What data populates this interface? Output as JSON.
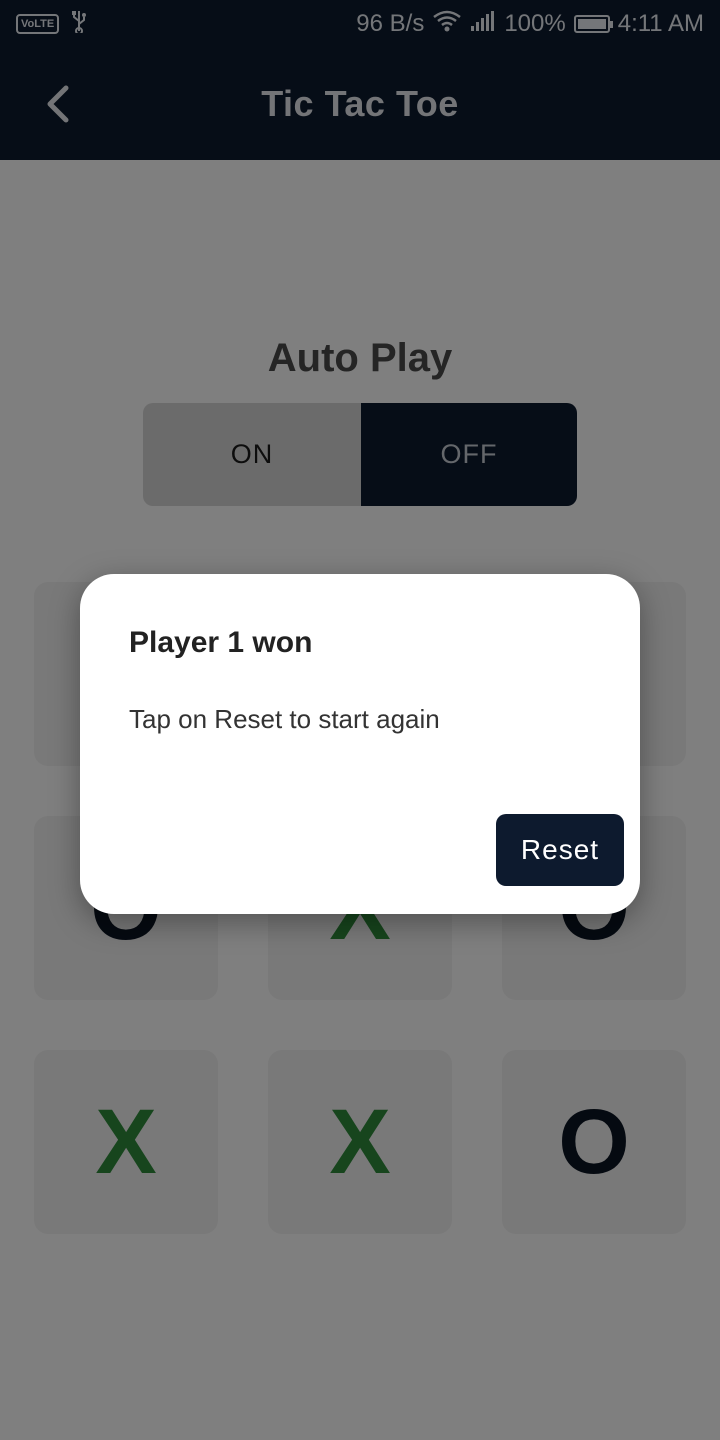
{
  "status": {
    "volte": "VoLTE",
    "net_speed": "96 B/s",
    "battery": "100%",
    "time": "4:11 AM",
    "battery_level": 1.0
  },
  "app_bar": {
    "title": "Tic Tac Toe",
    "back_icon": "chevron-left-icon"
  },
  "auto_play": {
    "title": "Auto Play",
    "on_label": "ON",
    "off_label": "OFF",
    "selected": "OFF"
  },
  "board": {
    "cells": [
      "",
      "",
      "",
      "O",
      "X",
      "O",
      "X",
      "X",
      "O"
    ]
  },
  "dialog": {
    "title": "Player 1 won",
    "message": "Tap on Reset to start again",
    "reset_label": "Reset"
  },
  "colors": {
    "primary": "#0d1a2e",
    "x_mark": "#2e8b3a",
    "o_mark": "#0b1422",
    "scrim": "rgba(0,0,0,0.5)"
  }
}
